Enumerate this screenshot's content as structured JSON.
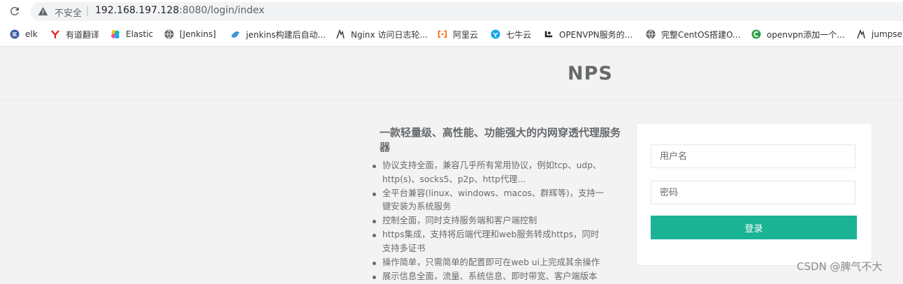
{
  "browser": {
    "security_label": "不安全",
    "separator": "|",
    "url_host": "192.168.197.128",
    "url_rest": ":8080/login/index",
    "bookmarks": [
      {
        "label": "elk",
        "icon": "elk-icon",
        "color": "#3c5ea8"
      },
      {
        "label": "有道翻译",
        "icon": "youdao-icon",
        "color": "#e02020"
      },
      {
        "label": "Elastic",
        "icon": "elastic-icon",
        "color": "#00bfb3"
      },
      {
        "label": "[Jenkins]",
        "icon": "globe-icon",
        "color": "#5f6368"
      },
      {
        "label": "jenkins构建后自动...",
        "icon": "bird-icon",
        "color": "#3a9ad9"
      },
      {
        "label": "Nginx 访问日志轮...",
        "icon": "feather-icon",
        "color": "#444444"
      },
      {
        "label": "阿里云",
        "icon": "aliyun-icon",
        "color": "#ff6a00"
      },
      {
        "label": "七牛云",
        "icon": "qiniu-icon",
        "color": "#10a7e8"
      },
      {
        "label": "OPENVPN服务的...",
        "icon": "openvpn-icon",
        "color": "#222222"
      },
      {
        "label": "完整CentOS搭建O...",
        "icon": "globe-icon",
        "color": "#5f6368"
      },
      {
        "label": "openvpn添加一个...",
        "icon": "c-logo-icon",
        "color": "#2e9e44"
      },
      {
        "label": "jumpser",
        "icon": "feather-icon",
        "color": "#444444"
      }
    ]
  },
  "page": {
    "brand": "NPS",
    "intro_title": "一款轻量级、高性能、功能强大的内网穿透代理服务器",
    "features": [
      [
        "协议支持全面，兼容几乎所有常用协议，例如tcp、udp、",
        "http(s)、socks5、p2p、http代理..."
      ],
      [
        "全平台兼容(linux、windows、macos、群辉等)，支持一",
        "键安装为系统服务"
      ],
      [
        "控制全面，同时支持服务端和客户端控制"
      ],
      [
        "https集成，支持将后端代理和web服务转成https，同时",
        "支持多证书"
      ],
      [
        "操作简单，只需简单的配置即可在web ui上完成其余操作"
      ],
      [
        "展示信息全面，流量、系统信息、即时带宽、客户端版本"
      ]
    ]
  },
  "login": {
    "username_placeholder": "用户名",
    "password_placeholder": "密码",
    "submit_label": "登录"
  },
  "watermark": "CSDN @脾气不大",
  "colors": {
    "accent": "#1ab394",
    "text": "#676a6c",
    "background": "#f3f3f4"
  }
}
